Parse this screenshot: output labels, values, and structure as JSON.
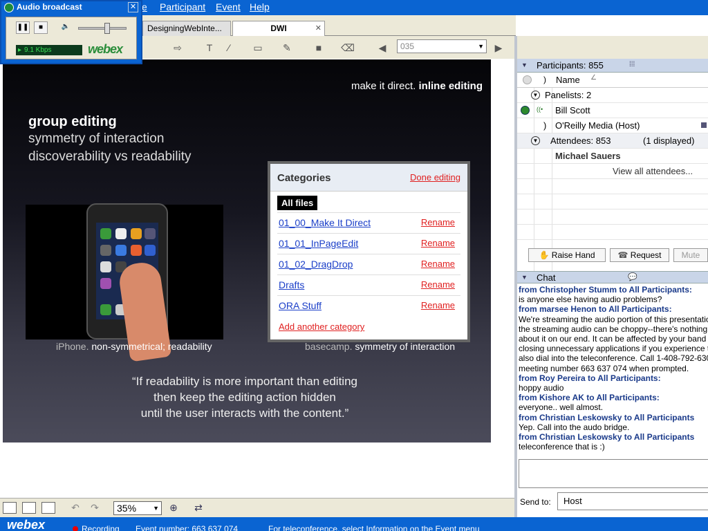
{
  "menubar": {
    "items": [
      "e",
      "Participant",
      "Event",
      "Help"
    ]
  },
  "audio": {
    "title": "Audio broadcast",
    "bitrate": "9.1 Kbps",
    "logo": "webex",
    "volume_level": 0.6
  },
  "tabs": [
    {
      "label": "DesigningWebInte..."
    },
    {
      "label": "DWI"
    }
  ],
  "toolbar": {
    "page_field": "035"
  },
  "slide": {
    "headline_plain": "make it direct.",
    "headline_bold": "inline editing",
    "h1": "group editing",
    "line1": "symmetry of interaction",
    "line2": "discoverability vs readability",
    "caption_left_plain": "iPhone.",
    "caption_left_bold": "non-symmetrical; readability",
    "caption_right_plain": "basecamp.",
    "caption_right_bold": "symmetry of interaction",
    "quote1": "“If readability is more important than editing",
    "quote2": "then keep the editing action hidden",
    "quote3": "until the user interacts with the content.”",
    "categories": {
      "title": "Categories",
      "done": "Done editing",
      "all": "All files",
      "rename": "Rename",
      "items": [
        "01_00_Make It Direct",
        "01_01_InPageEdit",
        "01_02_DragDrop",
        "Drafts",
        "ORA Stuff"
      ],
      "add": "Add another category"
    }
  },
  "viewbar": {
    "zoom": "35%"
  },
  "status": {
    "logo": "webex",
    "recording": "Recording",
    "event": "Event number: 663 637 074",
    "telecon": "For teleconference, select Information on the Event menu"
  },
  "participants": {
    "header": "Participants: 855",
    "col_name": "Name",
    "panelists": "Panelists: 2",
    "p1": "Bill Scott",
    "p2": "O'Reilly Media (Host)",
    "attendees": "Attendees: 853",
    "displayed": "(1 displayed)",
    "a1": "Michael Sauers",
    "view_all": "View all attendees..."
  },
  "buttons": {
    "raise_hand": "Raise Hand",
    "request": "Request",
    "mute": "Mute"
  },
  "chat": {
    "header": "Chat",
    "lines": [
      {
        "from": true,
        "text": "from Christopher Stumm to All Participants:"
      },
      {
        "from": false,
        "text": "is anyone else having audio problems?"
      },
      {
        "from": true,
        "text": "from marsee Henon to All Participants:"
      },
      {
        "from": false,
        "text": "We're streaming the audio portion of this presentatio"
      },
      {
        "from": false,
        "text": " the streaming audio can be choppy--there's nothing"
      },
      {
        "from": false,
        "text": "about it on our end. It can be affected by your band"
      },
      {
        "from": false,
        "text": "closing unnecessary applications if you experience t"
      },
      {
        "from": false,
        "text": "also dial into the teleconference. Call 1-408-792-630"
      },
      {
        "from": false,
        "text": "meeting number 663 637 074 when prompted."
      },
      {
        "from": true,
        "text": "from Roy Pereira to All Participants:"
      },
      {
        "from": false,
        "text": "hoppy audio"
      },
      {
        "from": true,
        "text": "from Kishore AK to All Participants:"
      },
      {
        "from": false,
        "text": "everyone.. well almost."
      },
      {
        "from": true,
        "text": "from Christian Leskowsky to All Participants"
      },
      {
        "from": false,
        "text": "Yep. Call into the audo bridge."
      },
      {
        "from": true,
        "text": "from Christian Leskowsky to All Participants"
      },
      {
        "from": false,
        "text": "teleconference that is :)"
      }
    ],
    "send_to_label": "Send to:",
    "send_to_value": "Host"
  }
}
